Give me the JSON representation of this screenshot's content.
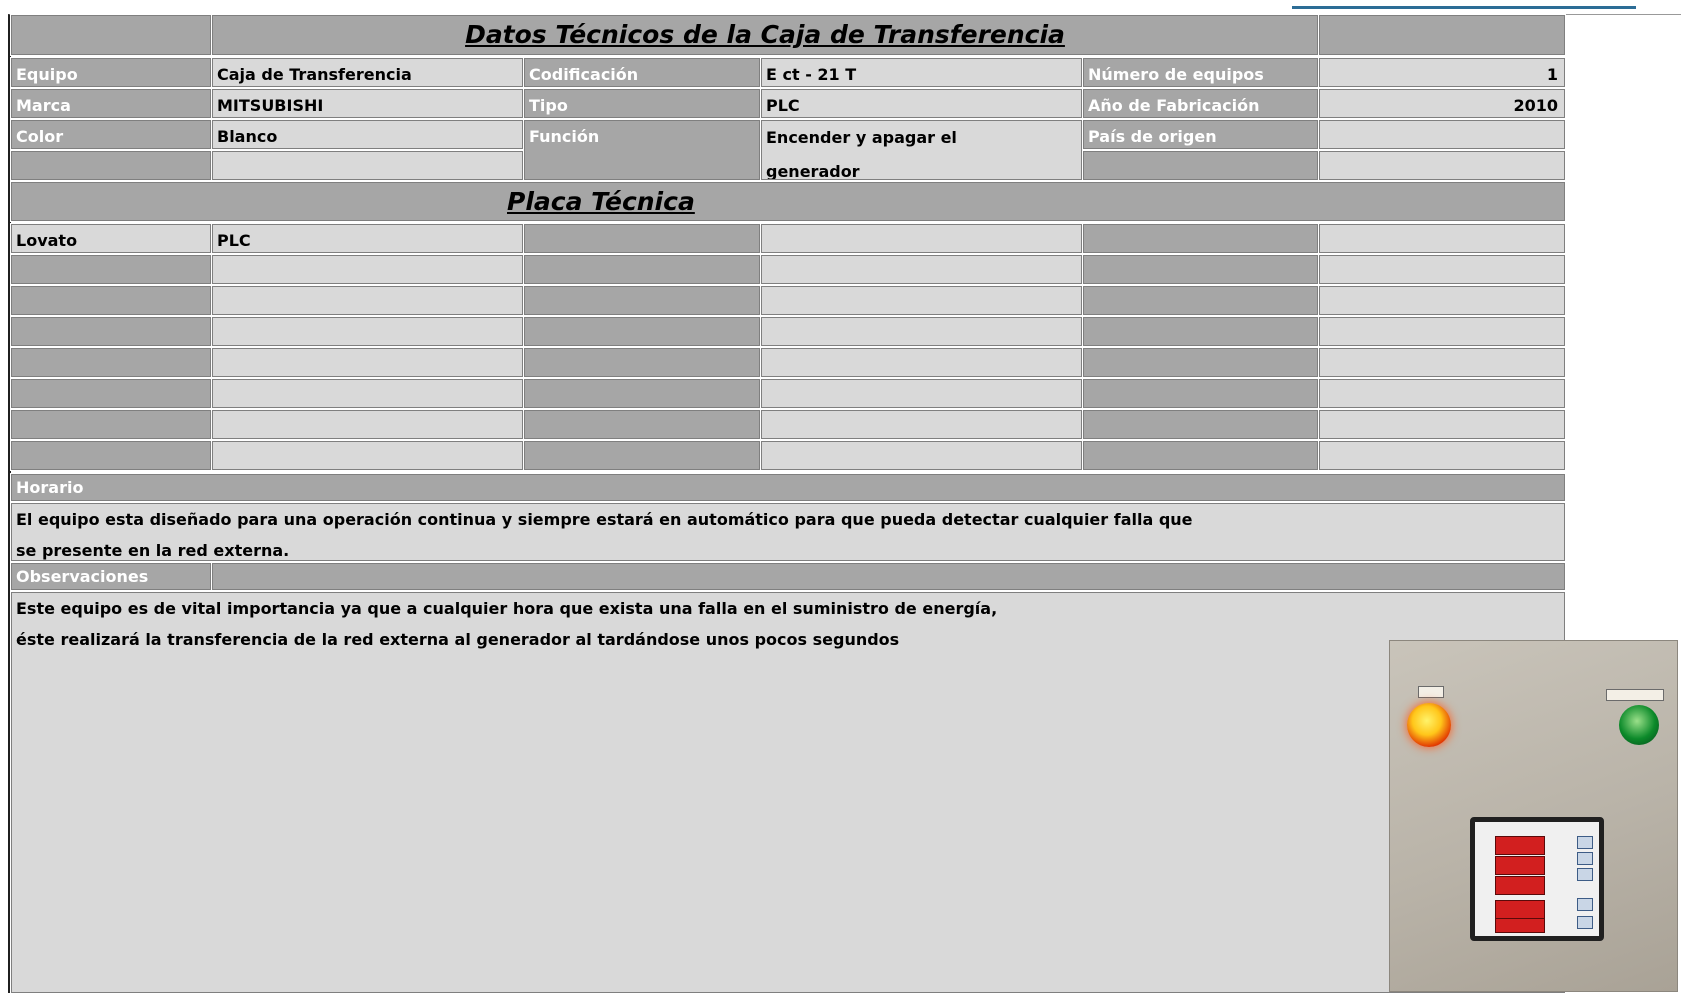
{
  "title": "Datos Técnicos de la Caja de Transferencia",
  "specs": {
    "equipo_label": "Equipo",
    "equipo_value": "Caja de Transferencia",
    "codificacion_label": "Codificación",
    "codificacion_value": "E ct - 21 T",
    "numero_label": "Número de equipos",
    "numero_value": "1",
    "marca_label": "Marca",
    "marca_value": "MITSUBISHI",
    "tipo_label": "Tipo",
    "tipo_value": "PLC",
    "anio_label": "Año de Fabricación",
    "anio_value": "2010",
    "color_label": "Color",
    "color_value": "Blanco",
    "funcion_label": "Función",
    "funcion_value": "Encender y apagar el generador",
    "pais_label": "País de origen",
    "pais_value": ""
  },
  "placa": {
    "title": "Placa  Técnica",
    "row1": [
      "Lovato",
      "PLC"
    ]
  },
  "horario": {
    "label": "Horario",
    "text": "El equipo esta diseñado para una operación continua y siempre estará en automático para que pueda detectar cualquier falla que se presente en la red externa."
  },
  "observaciones": {
    "label": "Observaciones",
    "text_line1": "Este equipo es de vital importancia ya que a cualquier hora que exista una falla en el suministro de energía,",
    "text_line2": "éste realizará la transferencia de la red externa al generador al tardándose unos pocos segundos"
  },
  "colors": {
    "dark_cell": "#a6a6a6",
    "light_cell": "#d9d9d9",
    "label_text": "#ffffff"
  }
}
